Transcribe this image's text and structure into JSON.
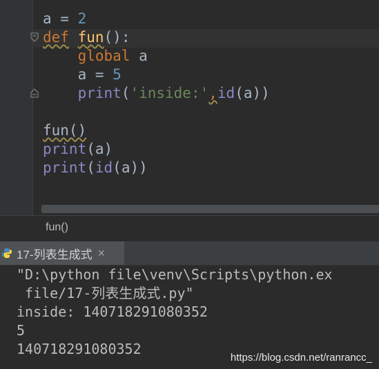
{
  "editor": {
    "lines": {
      "l1": {
        "a": "a",
        "eq": " = ",
        "num": "2"
      },
      "l2": {
        "kw": "def",
        "sp": " ",
        "fn": "fun",
        "rest": "():"
      },
      "l3": {
        "indent": "    ",
        "kw": "global",
        "rest": " a"
      },
      "l4": {
        "indent": "    ",
        "a": "a",
        "eq": " = ",
        "num": "5"
      },
      "l5": {
        "indent": "    ",
        "bi": "print",
        "p1": "(",
        "str": "'inside:'",
        "comma": ",",
        "bi2": "id",
        "rest": "(a))"
      },
      "l7": {
        "call": "fun()"
      },
      "l8": {
        "bi": "print",
        "rest": "(a)"
      },
      "l9": {
        "bi": "print",
        "p1": "(",
        "bi2": "id",
        "rest": "(a))"
      }
    }
  },
  "breadcrumb": {
    "text": "fun()"
  },
  "run_tab": {
    "label": "17-列表生成式",
    "close": "×"
  },
  "console": {
    "lines": [
      "\"D:\\python file\\venv\\Scripts\\python.ex",
      " file/17-列表生成式.py\"",
      "inside: 140718291080352",
      "5",
      "140718291080352"
    ]
  },
  "watermark": "https://blog.csdn.net/ranrancc_",
  "colors": {
    "background": "#2b2b2b",
    "keyword": "#cc7832",
    "number": "#6897bb",
    "function": "#ffc66d",
    "builtin": "#8888c6",
    "string": "#6a8759"
  }
}
